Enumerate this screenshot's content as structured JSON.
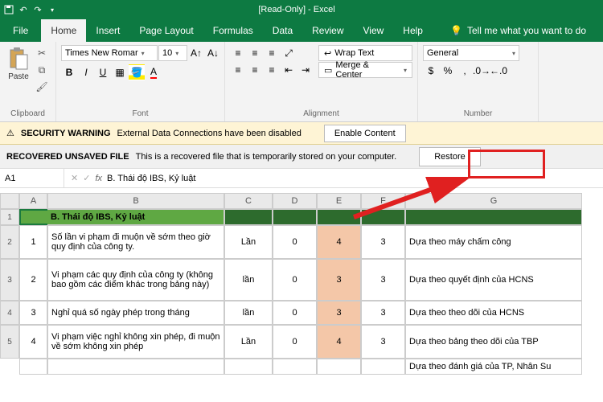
{
  "title": "[Read-Only]  -  Excel",
  "menu": {
    "file": "File",
    "home": "Home",
    "insert": "Insert",
    "pagelayout": "Page Layout",
    "formulas": "Formulas",
    "data": "Data",
    "review": "Review",
    "view": "View",
    "help": "Help",
    "tell": "Tell me what you want to do"
  },
  "ribbon": {
    "clipboard": {
      "paste": "Paste",
      "label": "Clipboard"
    },
    "font": {
      "name": "Times New Romar",
      "size": "10",
      "label": "Font"
    },
    "alignment": {
      "wrap": "Wrap Text",
      "merge": "Merge & Center",
      "label": "Alignment"
    },
    "number": {
      "format": "General",
      "label": "Number"
    }
  },
  "security": {
    "title": "SECURITY WARNING",
    "msg": "External Data Connections have been disabled",
    "btn": "Enable Content"
  },
  "recovered": {
    "title": "RECOVERED UNSAVED FILE",
    "msg": "This is a recovered file that is temporarily stored on your computer.",
    "btn": "Restore"
  },
  "formula": {
    "cell": "A1",
    "value": "B. Thái độ IBS, Kỷ luật"
  },
  "cols": [
    "A",
    "B",
    "C",
    "D",
    "E",
    "F",
    "G"
  ],
  "rows": [
    "1",
    "2",
    "3",
    "4",
    "5"
  ],
  "header_text": "B. Thái độ IBS, Kỷ luật",
  "data": [
    {
      "n": "1",
      "desc": "Số lần vi phạm đi muộn về sớm theo giờ quy định của công ty.",
      "unit": "Lần",
      "d": "0",
      "e": "4",
      "f": "3",
      "g": "Dựa theo máy chấm công"
    },
    {
      "n": "2",
      "desc": "Vi phạm các quy định của công ty (không bao gồm các điểm khác trong bảng này)",
      "unit": "lần",
      "d": "0",
      "e": "3",
      "f": "3",
      "g": "Dựa theo quyết định của HCNS"
    },
    {
      "n": "3",
      "desc": "Nghỉ quá số ngày phép trong tháng",
      "unit": "lần",
      "d": "0",
      "e": "3",
      "f": "3",
      "g": "Dựa theo theo dõi của HCNS"
    },
    {
      "n": "4",
      "desc": "Vi phạm việc nghỉ không xin phép, đi muộn về sớm không xin phép",
      "unit": "Lần",
      "d": "0",
      "e": "4",
      "f": "3",
      "g": "Dựa theo bảng theo dõi của TBP"
    },
    {
      "n": "",
      "desc": "",
      "unit": "",
      "d": "",
      "e": "",
      "f": "",
      "g": "Dựa theo đánh giá của TP, Nhân Su"
    }
  ]
}
